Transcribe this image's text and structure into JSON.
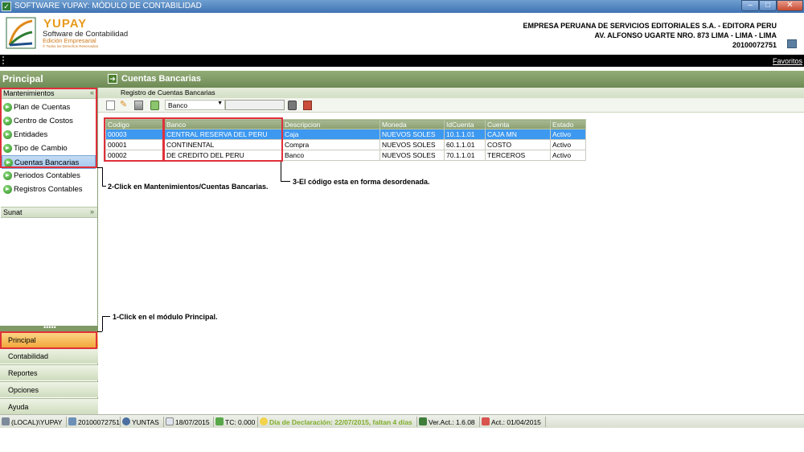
{
  "window": {
    "title": "SOFTWARE YUPAY: MÓDULO DE CONTABILIDAD",
    "min": "–",
    "max": "□",
    "close": "✕"
  },
  "brand": {
    "name": "YUPAY",
    "subtitle": "Software de Contabilidad",
    "edition": "Edición Empresarial",
    "rights": "© Todos los Derechos Reservados"
  },
  "company": {
    "name": "EMPRESA PERUANA DE SERVICIOS EDITORIALES S.A. - EDITORA PERU",
    "address": "AV. ALFONSO UGARTE NRO. 873 LIMA - LIMA - LIMA",
    "ruc": "20100072751"
  },
  "favoritos": "Favoritos",
  "sidebar": {
    "title": "Principal",
    "mantenimientos": "Mantenimientos",
    "sunat": "Sunat",
    "collapse_icon": "«",
    "expand_icon": "»",
    "items": [
      {
        "label": "Plan de Cuentas"
      },
      {
        "label": "Centro de Costos"
      },
      {
        "label": "Entidades"
      },
      {
        "label": "Tipo de Cambio"
      },
      {
        "label": "Cuentas Bancarias"
      },
      {
        "label": "Periodos Contables"
      },
      {
        "label": "Registros Contables"
      }
    ],
    "handle": "•••••",
    "modules": [
      {
        "label": "Principal"
      },
      {
        "label": "Contabilidad"
      },
      {
        "label": "Reportes"
      },
      {
        "label": "Opciones"
      },
      {
        "label": "Ayuda"
      }
    ]
  },
  "main": {
    "title": "Cuentas Bancarias",
    "subtitle": "Registro de Cuentas Bancarias",
    "filter_value": "Banco",
    "search_value": ""
  },
  "grid": {
    "columns": [
      "Codigo",
      "Banco",
      "Descripcion",
      "Moneda",
      "IdCuenta",
      "Cuenta",
      "Estado"
    ],
    "rows": [
      [
        "00003",
        "CENTRAL RESERVA DEL PERU",
        "Caja",
        "NUEVOS SOLES",
        "10.1.1.01",
        "CAJA MN",
        "Activo"
      ],
      [
        "00001",
        "CONTINENTAL",
        "Compra",
        "NUEVOS SOLES",
        "60.1.1.01",
        "COSTO",
        "Activo"
      ],
      [
        "00002",
        "DE CREDITO DEL PERU",
        "Banco",
        "NUEVOS SOLES",
        "70.1.1.01",
        "TERCEROS",
        "Activo"
      ]
    ]
  },
  "annotations": {
    "note1": "1-Click en el módulo Principal.",
    "note2": "2-Click en Mantenimientos/Cuentas Bancarias.",
    "note3": "3-El código esta en forma desordenada."
  },
  "status": {
    "server": "(LOCAL)\\YUPAY",
    "ruc": "20100072751",
    "user": "YUNTAS",
    "date": "18/07/2015",
    "tc": "TC: 0.000",
    "declaracion": "Día de Declaración: 22/07/2015, faltan 4 días",
    "version": "Ver.Act.: 1.6.08",
    "act": "Act.: 01/04/2015"
  },
  "colors": {
    "accent_green": "#7f9a65",
    "selected_blue": "#3d98f0",
    "highlight_red": "#e0303a",
    "status_green": "#7fae2a"
  },
  "icons": {
    "new": "new-document-icon",
    "edit": "pencil-icon",
    "delete": "trash-icon",
    "refresh": "refresh-icon",
    "find": "binoculars-icon",
    "exit": "exit-door-icon",
    "nav": "green-arrow-icon"
  }
}
